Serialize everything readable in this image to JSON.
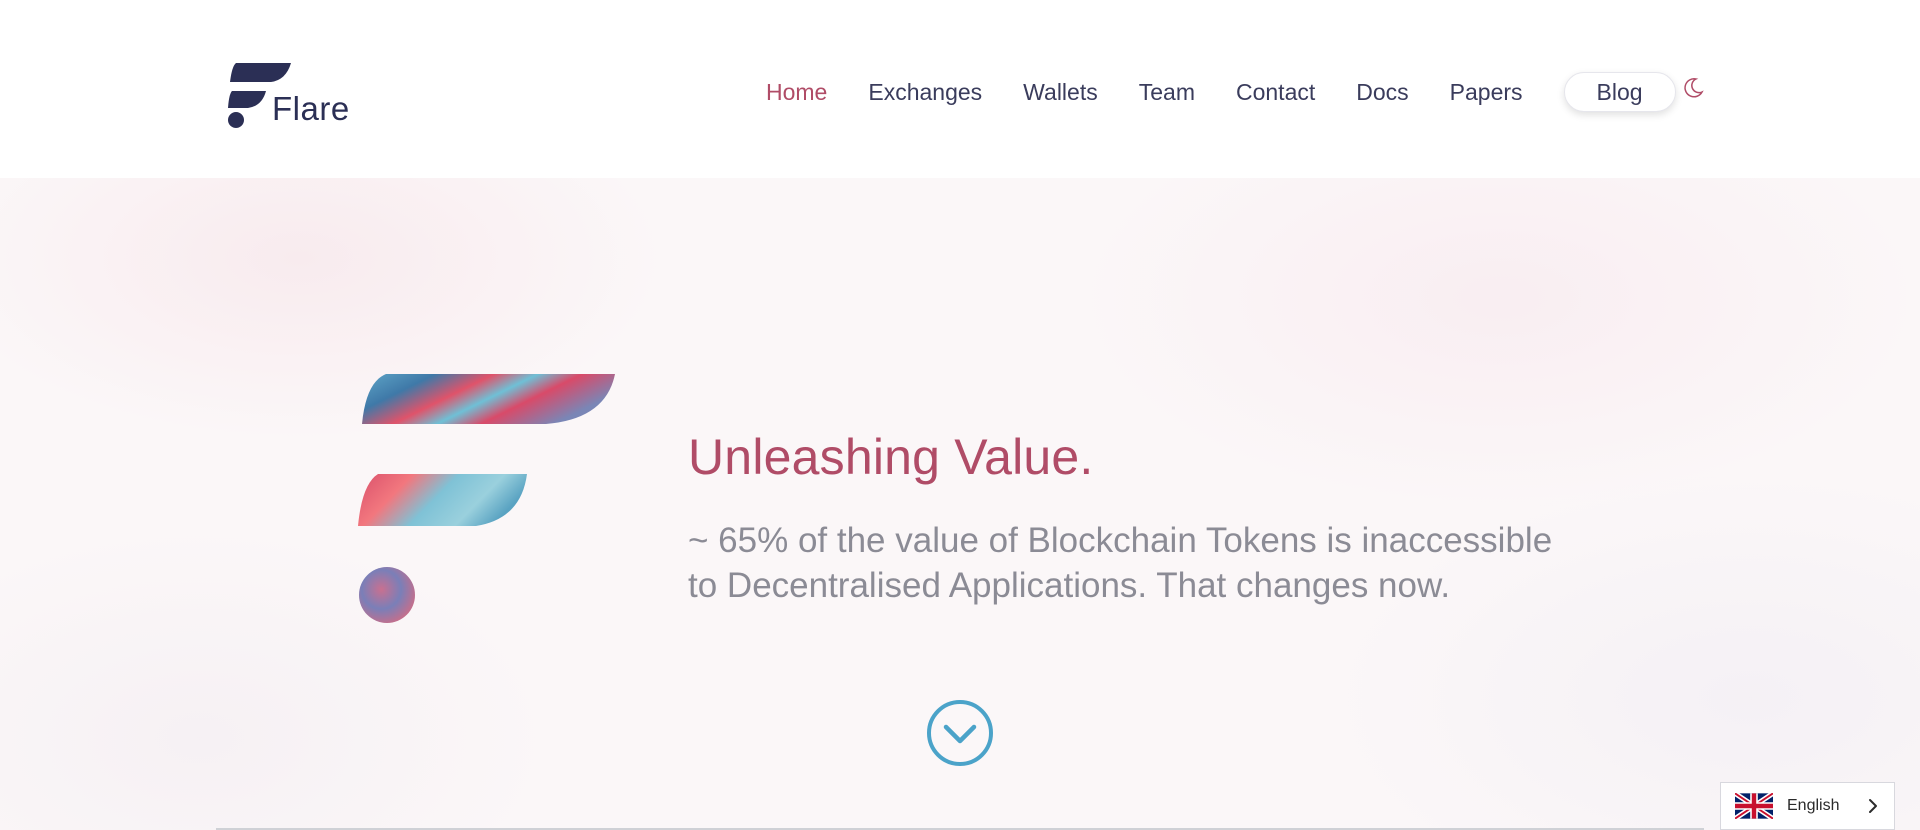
{
  "brand": {
    "name": "Flare"
  },
  "nav": {
    "items": [
      {
        "label": "Home",
        "active": true
      },
      {
        "label": "Exchanges",
        "active": false
      },
      {
        "label": "Wallets",
        "active": false
      },
      {
        "label": "Team",
        "active": false
      },
      {
        "label": "Contact",
        "active": false
      },
      {
        "label": "Docs",
        "active": false
      },
      {
        "label": "Papers",
        "active": false
      }
    ],
    "blog_label": "Blog",
    "theme_toggle_icon": "moon-icon"
  },
  "hero": {
    "headline": "Unleashing Value.",
    "subtext": "~ 65% of the value of Blockchain Tokens is inaccessible to Decentralised Applications. That changes now.",
    "scroll_icon": "chevron-circle-down-icon"
  },
  "language": {
    "label": "English",
    "flag_icon": "uk-flag-icon",
    "chevron_icon": "chevron-right-icon"
  },
  "colors": {
    "accent": "#b04c67",
    "brand_navy": "#2b2f55",
    "nav_text": "#3a3c5c",
    "subtext": "#8b8b95",
    "scroll_blue": "#4ba3c9"
  }
}
